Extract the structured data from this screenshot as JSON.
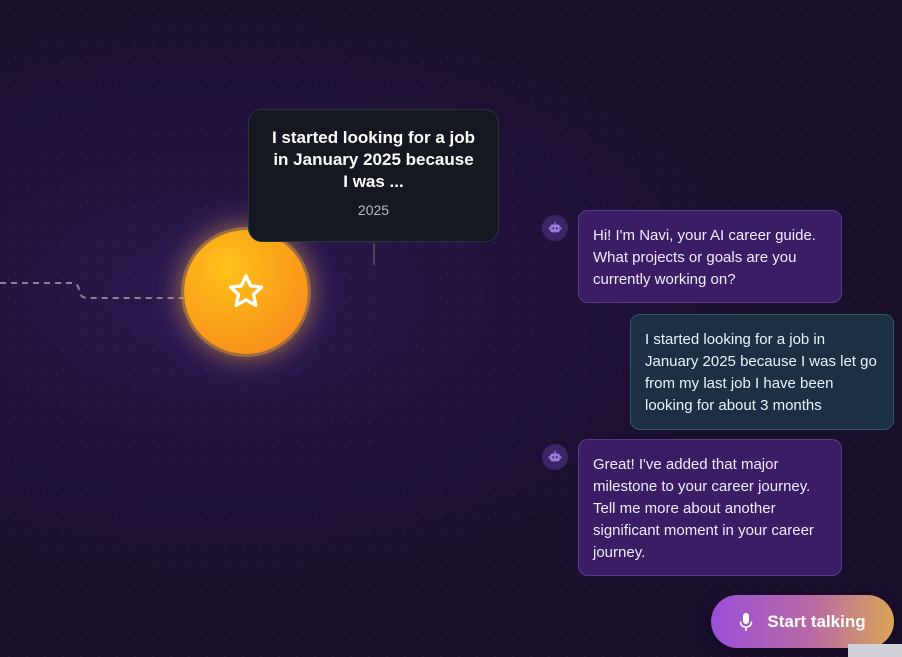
{
  "timeline": {
    "milestone": {
      "title": "I started looking for a job in January 2025 because I was ...",
      "year": "2025",
      "icon": "star-icon"
    }
  },
  "chat": {
    "messages": [
      {
        "role": "bot",
        "text": "Hi! I'm Navi, your AI career guide. What projects or goals are you currently working on?"
      },
      {
        "role": "user",
        "text": "I started looking for a job in January 2025 because I was let go from my last job I have been looking for about 3 months"
      },
      {
        "role": "bot",
        "text": "Great! I've added that major milestone to your career journey. Tell me more about another significant moment in your career journey."
      }
    ]
  },
  "controls": {
    "start_talking_label": "Start talking",
    "mic_icon": "microphone-icon"
  },
  "colors": {
    "background": "#1b0f2e",
    "milestone_fill": "#fba51a",
    "bot_bubble": "#3b1d66",
    "user_bubble": "#1c2f45",
    "button_gradient_start": "#9a4fd8",
    "button_gradient_end": "#d9a555"
  }
}
